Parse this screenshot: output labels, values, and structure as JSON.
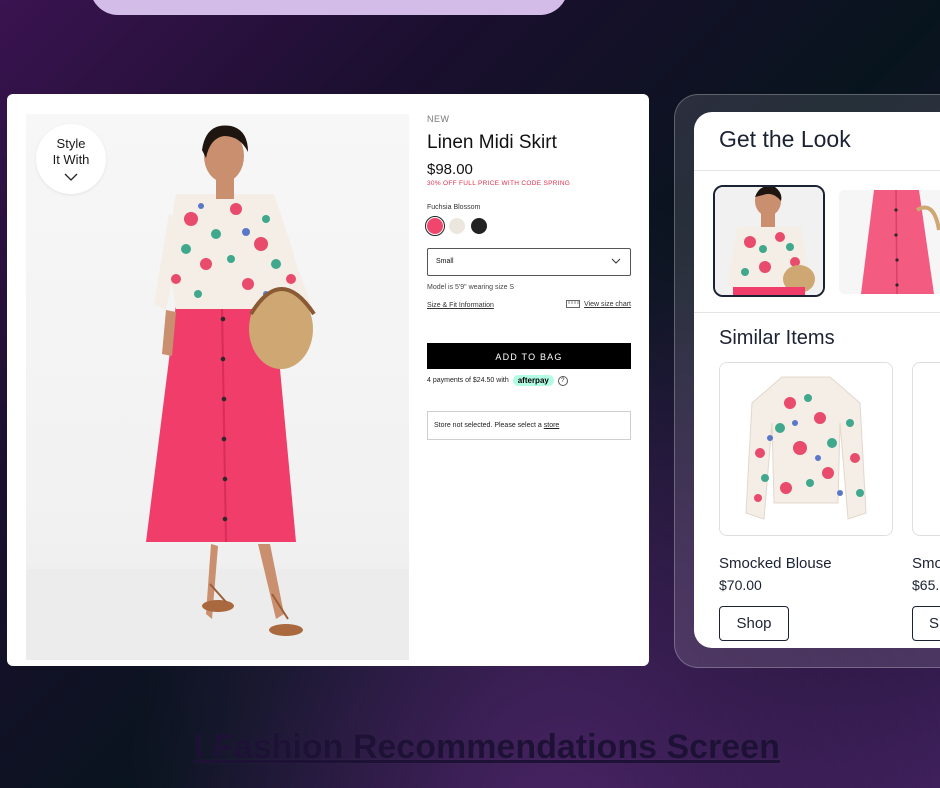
{
  "product": {
    "badge": "Style\nIt With",
    "new_tag": "NEW",
    "title": "Linen Midi Skirt",
    "price": "$98.00",
    "promo": "30% OFF FULL PRICE WITH CODE SPRING",
    "color_label": "Fuchsia Blossom",
    "swatches": [
      "#f0456c",
      "#ece7de",
      "#222222"
    ],
    "size_value": "Small",
    "model_note": "Model is 5'9\" wearing size S",
    "size_fit_link": "Size & Fit Information",
    "size_chart_link": "View size chart",
    "add_to_bag": "ADD TO BAG",
    "payments_text": "4 payments of $24.50 with",
    "afterpay": "afterpay",
    "store_text": "Store not selected. Please select a",
    "store_link": "store"
  },
  "look": {
    "title": "Get the Look",
    "similar_title": "Similar Items",
    "items": [
      {
        "name": "Smocked Blouse",
        "price": "$70.00",
        "button": "Shop"
      },
      {
        "name": "Smo",
        "price": "$65.",
        "button": "S"
      }
    ]
  },
  "caption": "I Fashion Recommendations Screen",
  "colors": {
    "accent_pink": "#f0456c",
    "dark_text": "#1b2233",
    "promo_red": "#e0304e"
  }
}
